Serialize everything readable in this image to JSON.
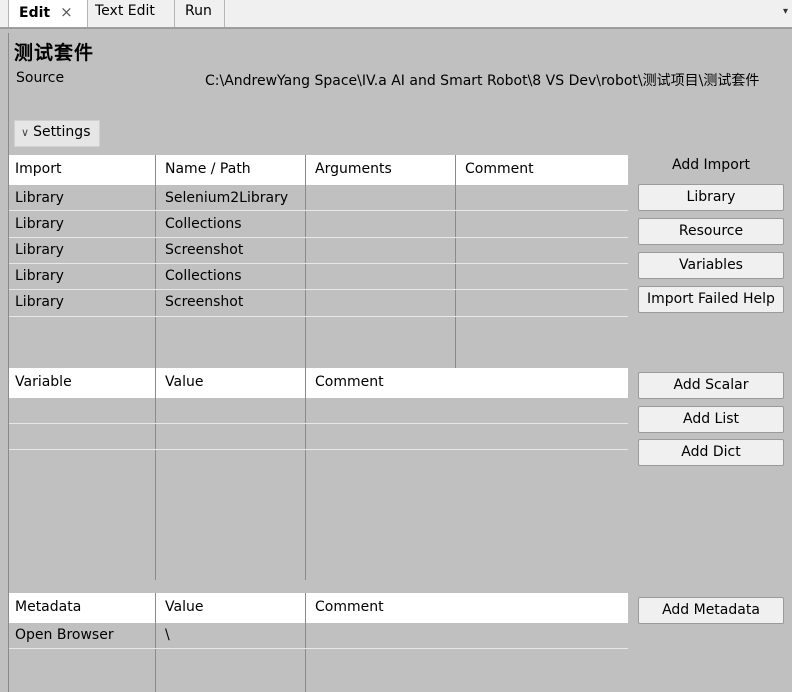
{
  "tabs": [
    {
      "label": "Edit",
      "close": "×"
    },
    {
      "label": "Text Edit"
    },
    {
      "label": "Run"
    }
  ],
  "tab_dropdown": "▾",
  "title": "测试套件",
  "source": {
    "label": "Source",
    "value": "C:\\AndrewYang Space\\IV.a AI and Smart Robot\\8 VS Dev\\robot\\测试项目\\测试套件"
  },
  "settings": {
    "chevron": "∨",
    "label": "Settings"
  },
  "imports": {
    "headers": [
      "Import",
      "Name / Path",
      "Arguments",
      "Comment"
    ],
    "rows": [
      [
        "Library",
        "Selenium2Library",
        "",
        ""
      ],
      [
        "Library",
        "Collections",
        "",
        ""
      ],
      [
        "Library",
        "Screenshot",
        "",
        ""
      ],
      [
        "Library",
        "Collections",
        "",
        ""
      ],
      [
        "Library",
        "Screenshot",
        "",
        ""
      ]
    ]
  },
  "import_buttons": {
    "label": "Add Import",
    "library": "Library",
    "resource": "Resource",
    "variables": "Variables",
    "import_failed_help": "Import Failed Help"
  },
  "variables": {
    "headers": [
      "Variable",
      "Value",
      "Comment"
    ],
    "rows": []
  },
  "variable_buttons": {
    "add_scalar": "Add Scalar",
    "add_list": "Add List",
    "add_dict": "Add Dict"
  },
  "metadata": {
    "headers": [
      "Metadata",
      "Value",
      "Comment"
    ],
    "rows": [
      [
        "Open Browser",
        "\\",
        ""
      ]
    ]
  },
  "metadata_buttons": {
    "add_metadata": "Add Metadata"
  },
  "colors": {
    "background": "#c0c0c0",
    "header_background": "#ffffff",
    "button_background": "#f0f0f0"
  }
}
